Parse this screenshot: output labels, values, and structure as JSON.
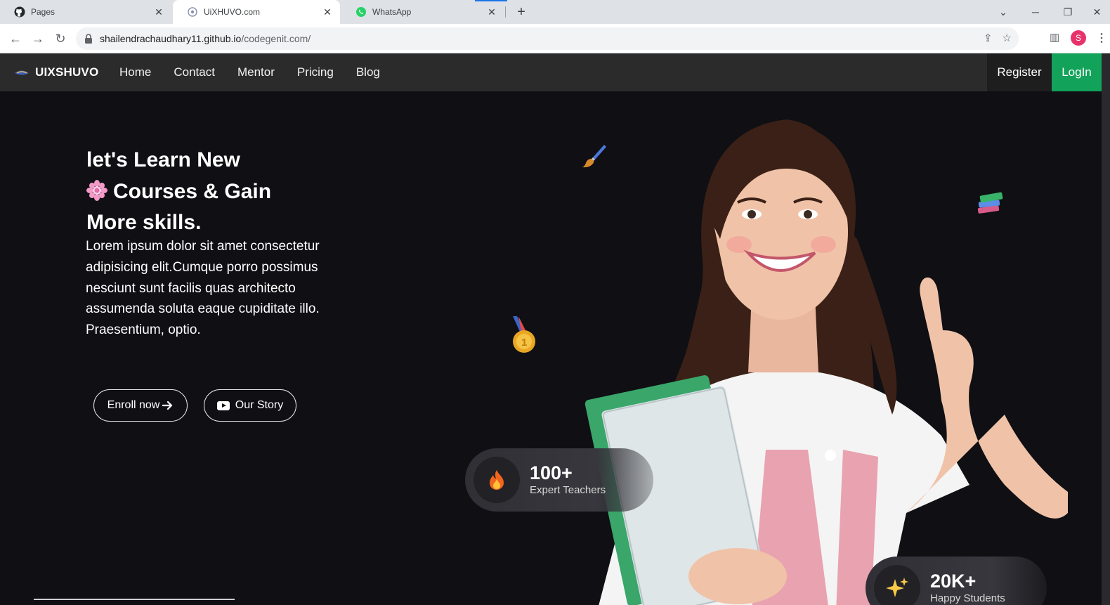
{
  "browser": {
    "tabs": [
      {
        "title": "Pages",
        "icon": "github-icon"
      },
      {
        "title": "UiXHUVO.com",
        "icon": "site-icon"
      },
      {
        "title": "WhatsApp",
        "icon": "whatsapp-icon"
      }
    ],
    "url_host": "shailendrachaudhary11.github.io",
    "url_path": "/codegenit.com/",
    "profile_initial": "S"
  },
  "navbar": {
    "brand": "UIXSHUVO",
    "links": [
      "Home",
      "Contact",
      "Mentor",
      "Pricing",
      "Blog"
    ],
    "register": "Register",
    "login": "LogIn"
  },
  "hero": {
    "headline_line1": "let's Learn New",
    "headline_line2": "Courses & Gain",
    "headline_line3": "More skills.",
    "lead": "Lorem ipsum dolor sit amet consectetur adipisicing elit.Cumque porro possimus nesciunt sunt facilis quas architecto assumenda soluta eaque cupiditate illo. Praesentium, optio.",
    "enroll_label": "Enroll now",
    "story_label": "Our Story"
  },
  "stats": [
    {
      "value": "100+",
      "label": "Expert Teachers",
      "icon": "fire-icon"
    },
    {
      "value": "20K+",
      "label": "Happy Students",
      "icon": "sparkles-icon"
    }
  ],
  "colors": {
    "hero_bg": "#0f0f14",
    "navbar_bg": "#2b2b2b",
    "login_bg": "#12a25a"
  }
}
